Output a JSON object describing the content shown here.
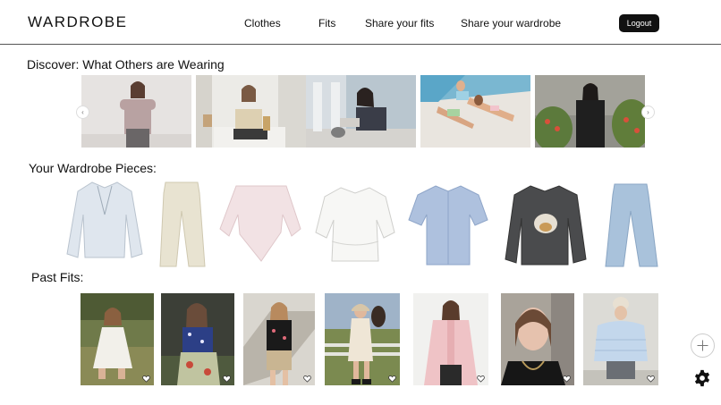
{
  "app": {
    "logo": "WARDROBE"
  },
  "nav": {
    "links": [
      "Clothes",
      "Fits",
      "Share your fits",
      "Share your wardrobe"
    ],
    "logout_label": "Logout"
  },
  "sections": {
    "discover_title": "Discover: What Others are Wearing",
    "wardrobe_title": "Your Wardrobe Pieces:",
    "past_title": "Past Fits:"
  },
  "discover_photos": [
    "person in mauve zip jacket",
    "person in cream knit cardigan seated",
    "person sitting on steps in grey",
    "two people lounging by pool",
    "person in black jacket by plants"
  ],
  "wardrobe_items": [
    "light blue cardigan",
    "beige trousers",
    "pink asymmetric top",
    "white peplum blouse",
    "blue striped shirt",
    "charcoal graphic sweatshirt",
    "light wash jeans"
  ],
  "past_fits": [
    "white dress outdoors",
    "blue floral top and skirt",
    "black heart cardigan",
    "cream shirt dress with horse",
    "pink shirt",
    "black top close-up",
    "light blue puffer jacket"
  ]
}
